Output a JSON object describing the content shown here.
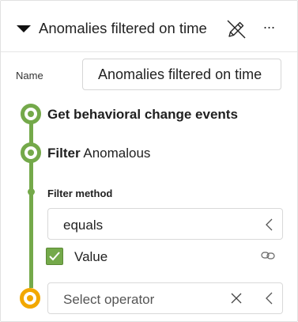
{
  "header": {
    "title": "Anomalies filtered on time",
    "more_label": "···"
  },
  "name_field": {
    "label": "Name",
    "value": "Anomalies filtered on time"
  },
  "steps": [
    {
      "bold": "Get behavioral change events",
      "rest": ""
    },
    {
      "bold": "Filter",
      "rest": "Anomalous"
    }
  ],
  "filter_method": {
    "heading": "Filter method",
    "selected": "equals"
  },
  "value_option": {
    "label": "Value",
    "checked": true
  },
  "operator_select": {
    "placeholder": "Select operator"
  },
  "colors": {
    "rail_green": "#74a94a",
    "pending_orange": "#f2a800"
  }
}
